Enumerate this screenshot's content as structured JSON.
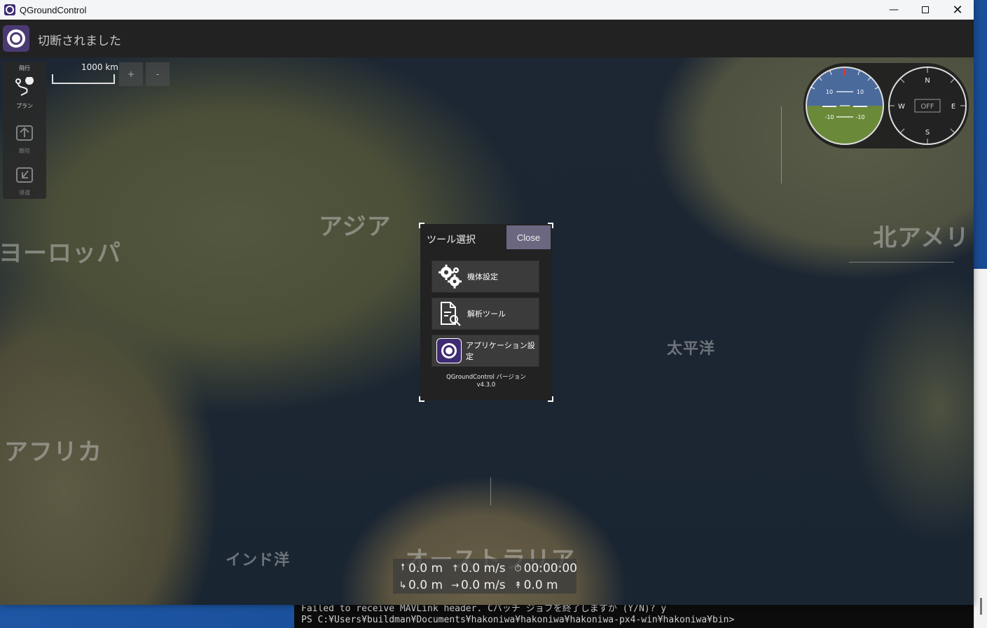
{
  "window": {
    "title": "QGroundControl",
    "controls": {
      "minimize": "—",
      "close": "✕"
    }
  },
  "toolbar": {
    "status": "切断されました"
  },
  "map": {
    "labels": {
      "asia": "アジア",
      "europe": "ヨーロッパ",
      "north_america": "北アメリ",
      "pacific": "太平洋",
      "africa": "アフリカ",
      "indian_ocean": "インド洋",
      "australia": "オーストラリア"
    },
    "scale": "1000 km",
    "zoom_in": "+",
    "zoom_out": "-"
  },
  "tools": {
    "fly": {
      "caption": "飛行",
      "icon": "fly-icon"
    },
    "plan": {
      "caption": "プラン",
      "icon": "plan-route-icon"
    },
    "takeoff": {
      "caption": "離陸",
      "icon": "takeoff-icon"
    },
    "return": {
      "caption": "帰還",
      "icon": "return-icon"
    }
  },
  "instruments": {
    "attitude": {
      "pitch_up_left": "10",
      "pitch_up_right": "10",
      "pitch_down_left": "-10",
      "pitch_down_right": "-10",
      "sky_color": "#4a6a9c",
      "ground_color": "#6a8a3a"
    },
    "compass": {
      "north": "N",
      "south": "S",
      "east": "E",
      "west": "W",
      "heading": "OFF"
    }
  },
  "tool_dialog": {
    "title": "ツール選択",
    "close_label": "Close",
    "buttons": [
      {
        "label": "機体設定",
        "icon": "gears-icon"
      },
      {
        "label": "解析ツール",
        "icon": "analyze-document-icon"
      },
      {
        "label": "アプリケーション設定",
        "icon": "qgc-logo-icon"
      }
    ],
    "version_label": "QGroundControl バージョン",
    "version": "v4.3.0"
  },
  "telemetry": {
    "altitude": "0.0 m",
    "vertical_speed": "0.0 m/s",
    "flight_time": "00:00:00",
    "distance_home": "0.0 m",
    "horizontal_speed": "0.0 m/s",
    "distance_start": "0.0 m"
  },
  "terminal": {
    "line1": "Failed to receive MAVLink header. Cバッチ ジョブを終了しますか (Y/N)? y",
    "line2": "PS C:¥Users¥buildman¥Documents¥hakoniwa¥hakoniwa¥hakoniwa-px4-win¥hakoniwa¥bin>"
  }
}
